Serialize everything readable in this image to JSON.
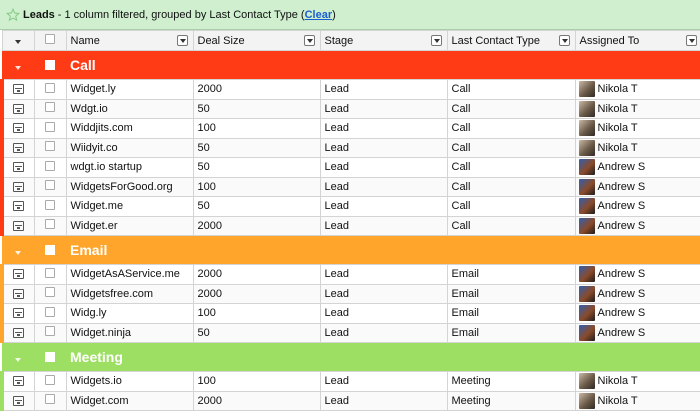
{
  "header": {
    "title": "Leads",
    "separator": "-",
    "subtitle": "1 column filtered, grouped by Last Contact Type (",
    "clear_link": "Clear",
    "close_paren": ")"
  },
  "columns": {
    "name": "Name",
    "deal_size": "Deal Size",
    "stage": "Stage",
    "last_contact_type": "Last Contact Type",
    "assigned_to": "Assigned To"
  },
  "colors": {
    "call": "#ff3b16",
    "email": "#ffa52b",
    "meeting": "#9ddf62"
  },
  "groups": {
    "call": {
      "label": "Call",
      "rows": [
        {
          "name": "Widget.ly",
          "deal": "2000",
          "stage": "Lead",
          "type": "Call",
          "assigned": "Nikola T",
          "avatar": "nikola"
        },
        {
          "name": "Wdgt.io",
          "deal": "50",
          "stage": "Lead",
          "type": "Call",
          "assigned": "Nikola T",
          "avatar": "nikola"
        },
        {
          "name": "Widdjits.com",
          "deal": "100",
          "stage": "Lead",
          "type": "Call",
          "assigned": "Nikola T",
          "avatar": "nikola"
        },
        {
          "name": "Wiidyit.co",
          "deal": "50",
          "stage": "Lead",
          "type": "Call",
          "assigned": "Nikola T",
          "avatar": "nikola"
        },
        {
          "name": "wdgt.io startup",
          "deal": "50",
          "stage": "Lead",
          "type": "Call",
          "assigned": "Andrew S",
          "avatar": "andrew"
        },
        {
          "name": "WidgetsForGood.org",
          "deal": "100",
          "stage": "Lead",
          "type": "Call",
          "assigned": "Andrew S",
          "avatar": "andrew"
        },
        {
          "name": "Widget.me",
          "deal": "50",
          "stage": "Lead",
          "type": "Call",
          "assigned": "Andrew S",
          "avatar": "andrew"
        },
        {
          "name": "Widget.er",
          "deal": "2000",
          "stage": "Lead",
          "type": "Call",
          "assigned": "Andrew S",
          "avatar": "andrew"
        }
      ]
    },
    "email": {
      "label": "Email",
      "rows": [
        {
          "name": "WidgetAsAService.me",
          "deal": "2000",
          "stage": "Lead",
          "type": "Email",
          "assigned": "Andrew S",
          "avatar": "andrew"
        },
        {
          "name": "Widgetsfree.com",
          "deal": "2000",
          "stage": "Lead",
          "type": "Email",
          "assigned": "Andrew S",
          "avatar": "andrew"
        },
        {
          "name": "Widg.ly",
          "deal": "100",
          "stage": "Lead",
          "type": "Email",
          "assigned": "Andrew S",
          "avatar": "andrew"
        },
        {
          "name": "Widget.ninja",
          "deal": "50",
          "stage": "Lead",
          "type": "Email",
          "assigned": "Andrew S",
          "avatar": "andrew"
        }
      ]
    },
    "meeting": {
      "label": "Meeting",
      "rows": [
        {
          "name": "Widgets.io",
          "deal": "100",
          "stage": "Lead",
          "type": "Meeting",
          "assigned": "Nikola T",
          "avatar": "nikola"
        },
        {
          "name": "Widget.com",
          "deal": "2000",
          "stage": "Lead",
          "type": "Meeting",
          "assigned": "Nikola T",
          "avatar": "nikola"
        }
      ]
    }
  }
}
